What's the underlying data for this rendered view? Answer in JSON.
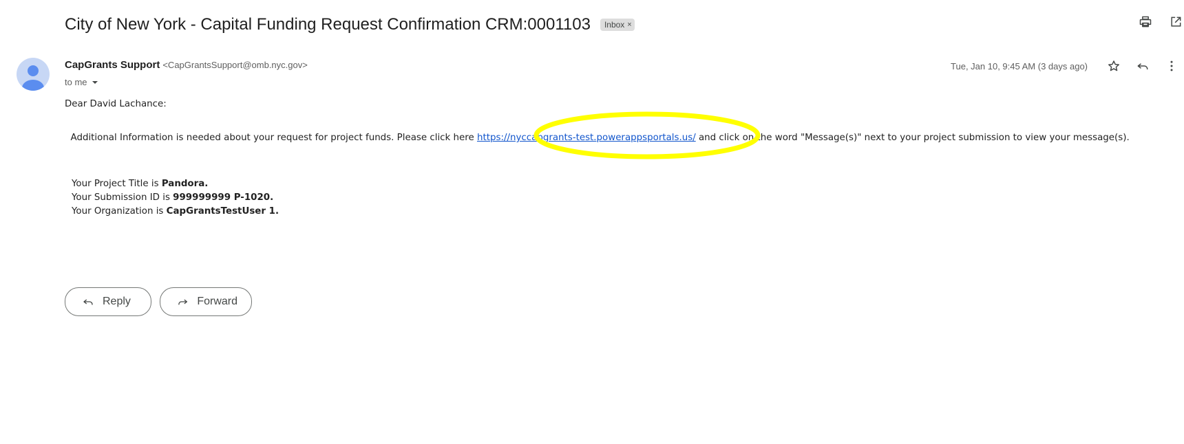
{
  "subject": "City of New York - Capital Funding Request Confirmation CRM:0001103",
  "label_chip": {
    "text": "Inbox",
    "close": "×"
  },
  "sender": {
    "name": "CapGrants Support",
    "email": "<CapGrantsSupport@omb.nyc.gov>",
    "to": "to me"
  },
  "date": "Tue, Jan 10, 9:45 AM (3 days ago)",
  "body": {
    "greeting": "Dear David Lachance:",
    "para_before": "Additional Information is needed about your request for project funds. Please click here ",
    "link": "https://nyccapgrants-test.powerappsportals.us/",
    "para_after": " and click on the word \"Message(s)\" next to your project submission to view your message(s).",
    "details": [
      {
        "label": "Your Project Title is ",
        "value": "Pandora."
      },
      {
        "label": "Your Submission ID is ",
        "value": "999999999 P-1020."
      },
      {
        "label": "Your Organization is ",
        "value": "CapGrantsTestUser 1."
      }
    ]
  },
  "actions": {
    "reply": "Reply",
    "forward": "Forward"
  },
  "icons": [
    "print-icon",
    "open-in-new-window-icon",
    "star-icon",
    "reply-icon",
    "more-vert-icon",
    "chevron-down-icon",
    "forward-icon"
  ],
  "colors": {
    "highlight": "#ffff00",
    "link": "#1155cc",
    "avatar_bg": "#c7d7f5",
    "avatar_fg": "#5b8def"
  }
}
